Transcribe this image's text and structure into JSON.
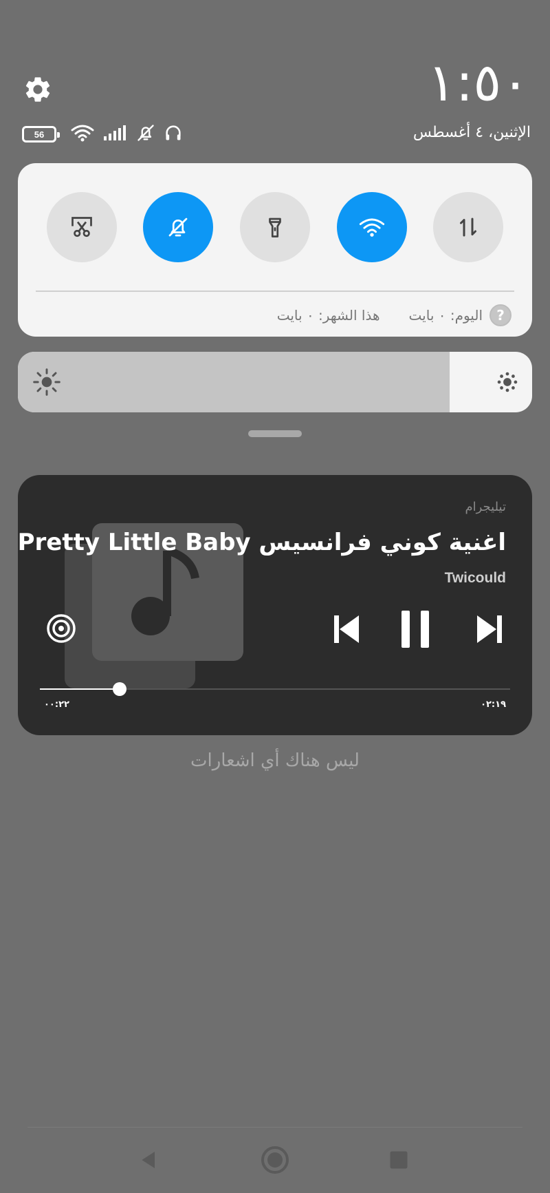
{
  "header": {
    "clock": "١:٥٠",
    "date": "الإثنين، ٤ أغسطس",
    "battery_level": "56"
  },
  "quick_settings": {
    "tiles": [
      {
        "name": "screenshot",
        "active": false
      },
      {
        "name": "do-not-disturb",
        "active": true
      },
      {
        "name": "flashlight",
        "active": false
      },
      {
        "name": "wifi",
        "active": true
      },
      {
        "name": "mobile-data",
        "active": false
      }
    ],
    "data_today": "اليوم: ٠ بايت",
    "data_month": "هذا الشهر: ٠ بايت",
    "help_label": "?"
  },
  "brightness": {
    "level": 0.84
  },
  "media": {
    "app_name": "تيليجرام",
    "title": "اغنية كوني فرانسيس Pretty Little Baby م..",
    "artist": "Twicould",
    "elapsed": "٠٠:٢٢",
    "duration": "٠٢:١٩",
    "progress": 0.17
  },
  "notifications": {
    "empty_text": "ليس هناك أي اشعارات"
  },
  "colors": {
    "accent": "#0d97f5",
    "background": "#6f6f6f",
    "panel": "#f4f4f4",
    "media_card": "#2c2c2c"
  }
}
